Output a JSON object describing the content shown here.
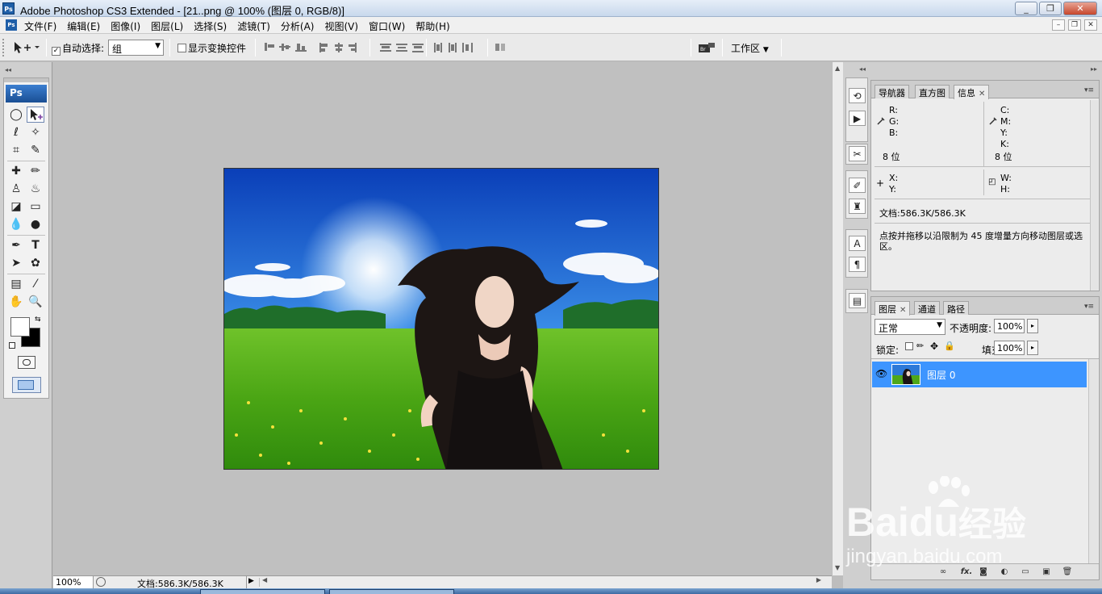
{
  "window": {
    "title": "Adobe Photoshop CS3 Extended - [21..png @ 100% (图层 0, RGB/8)]",
    "app_logo": "Ps",
    "buttons": {
      "minimize": "_",
      "restore": "❐",
      "close": "✕"
    }
  },
  "menu": {
    "logo": "Ps",
    "items": [
      "文件(F)",
      "编辑(E)",
      "图像(I)",
      "图层(L)",
      "选择(S)",
      "滤镜(T)",
      "分析(A)",
      "视图(V)",
      "窗口(W)",
      "帮助(H)"
    ],
    "doc_buttons": [
      "–",
      "❐",
      "✕"
    ]
  },
  "options": {
    "auto_select_label": "自动选择:",
    "auto_select_checked": true,
    "auto_select_value": "组",
    "show_transform_label": "显示变换控件",
    "show_transform_checked": false,
    "workspace_label": "工作区"
  },
  "toolbox": {
    "logo": "Ps",
    "foreground_color": "#ffffff",
    "background_color": "#000000"
  },
  "status": {
    "zoom": "100%",
    "doc_info": "文档:586.3K/586.3K"
  },
  "info_panel": {
    "tabs": [
      "导航器",
      "直方图",
      "信息"
    ],
    "active_tab": "信息",
    "rgb_labels": [
      "R:",
      "G:",
      "B:"
    ],
    "cmyk_labels": [
      "C:",
      "M:",
      "Y:",
      "K:"
    ],
    "bit_depth_left": "8 位",
    "bit_depth_right": "8 位",
    "xy_labels": [
      "X:",
      "Y:"
    ],
    "wh_labels": [
      "W:",
      "H:"
    ],
    "doc_info": "文档:586.3K/586.3K",
    "hint": "点按并拖移以沿限制为 45 度增量方向移动图层或选区。"
  },
  "layers_panel": {
    "tabs": [
      "图层",
      "通道",
      "路径"
    ],
    "active_tab": "图层",
    "blend_mode": "正常",
    "opacity_label": "不透明度:",
    "opacity_value": "100%",
    "lock_label": "锁定:",
    "fill_label": "填充:",
    "fill_value": "100%",
    "layers": [
      {
        "name": "图层 0",
        "visible": true,
        "selected": true
      }
    ],
    "footer_fx": "fx."
  },
  "watermark": {
    "brand": "Bai",
    "brand_suffix": "du",
    "brand_cn": "经验",
    "url": "jingyan.baidu.com"
  },
  "colors": {
    "selection": "#3d95ff",
    "canvas_bg": "#c0c0c0",
    "title_blue": "#1f5fa8"
  }
}
